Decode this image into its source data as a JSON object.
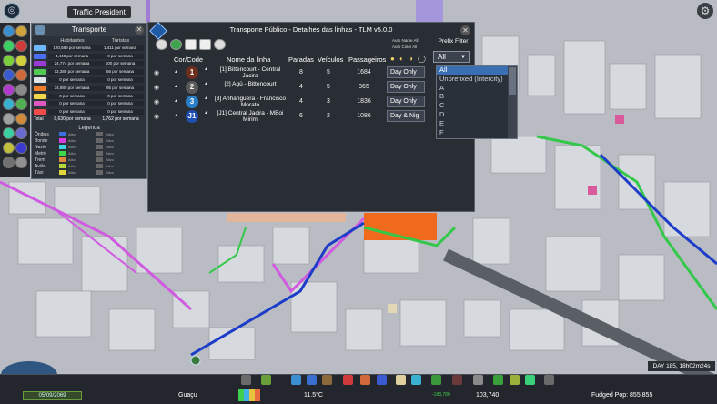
{
  "top": {
    "tag": "Traffic President"
  },
  "transport_panel": {
    "title": "Transporte",
    "headers": [
      "Habitantes",
      "Turistas"
    ],
    "rows": [
      {
        "color": "#6db8ff",
        "a": "120,589 por semana",
        "b": "1,411 por semana"
      },
      {
        "color": "#4b6ef4",
        "a": "4,440 por semana",
        "b": "0 por semana"
      },
      {
        "color": "#9a3bd8",
        "a": "24,774 por semana",
        "b": "100 por semana"
      },
      {
        "color": "#53c853",
        "a": "12,380 por semana",
        "b": "56 por semana"
      },
      {
        "color": "#dfe4ea",
        "a": "0 por semana",
        "b": "0 por semana"
      },
      {
        "color": "#ef7f2a",
        "a": "34,880 por semana",
        "b": "95 por semana"
      },
      {
        "color": "#f0d84a",
        "a": "0 por semana",
        "b": "0 por semana"
      },
      {
        "color": "#e056c0",
        "a": "0 por semana",
        "b": "0 por semana"
      },
      {
        "color": "#f04b4b",
        "a": "0 por semana",
        "b": "0 por semana"
      }
    ],
    "total_label": "Total",
    "total_a": "8,630 por semana",
    "total_b": "1,762 por semana",
    "legend_title": "Legenda",
    "legend": [
      {
        "name": "Ônibus",
        "color": "#3b6fe0",
        "a": "Ativo",
        "b": "Ativo"
      },
      {
        "name": "Bonde",
        "color": "#d83be0",
        "a": "Ativo",
        "b": "Ativo"
      },
      {
        "name": "Navio",
        "color": "#3bd4e0",
        "a": "Ativo",
        "b": "Ativo"
      },
      {
        "name": "Metrô",
        "color": "#3bd84a",
        "a": "Ativo",
        "b": "Ativo"
      },
      {
        "name": "Trem",
        "color": "#e0883b",
        "a": "Ativo",
        "b": "Ativo"
      },
      {
        "name": "Avião",
        "color": "#b4d83b",
        "a": "Ativo",
        "b": "Ativo"
      },
      {
        "name": "Táxi",
        "color": "#e0d83b",
        "a": "Ativo",
        "b": "Ativo"
      }
    ]
  },
  "detail_window": {
    "title": "Transporte Público - Detalhes das linhas - TLM v5.0.0",
    "auto_name": "Auto Name All",
    "auto_color": "Auto Color All",
    "prefix_filter": "Prefix Filter",
    "col_color": "Cor/Code",
    "col_name": "Nome da linha",
    "col_stops": "Paradas",
    "col_vehicles": "Veículos",
    "col_passengers": "Passageiros",
    "lines": [
      {
        "code": "1",
        "code_color": "#6e2e1e",
        "name": "[1] Bittencourt - Central Jacira",
        "stops": "8",
        "vehicles": "5",
        "passengers": "1684",
        "time": "Day Only"
      },
      {
        "code": "2",
        "code_color": "#5a5a5a",
        "name": "[2] Agü - Bittencourt",
        "stops": "4",
        "vehicles": "5",
        "passengers": "365",
        "time": "Day Only"
      },
      {
        "code": "3",
        "code_color": "#2a7fc8",
        "name": "[3] Anhanguera - Francisco Morato",
        "stops": "4",
        "vehicles": "3",
        "passengers": "1836",
        "time": "Day Only"
      },
      {
        "code": "J1",
        "code_color": "#1f4fb3",
        "name": "[J1] Central Jacira - MBoi Mirim",
        "stops": "6",
        "vehicles": "2",
        "passengers": "1086",
        "time": "Day & Nig"
      }
    ],
    "prefix_selected": "All",
    "prefix_options": [
      "All",
      "Unprefixed (Intercity)",
      "A",
      "B",
      "C",
      "D",
      "E",
      "F"
    ]
  },
  "bottom": {
    "day": "DAY 185, 18h02m24s",
    "date": "05/09/2069",
    "city": "Guaçu",
    "temperature": "11.5°C",
    "money": "103,740",
    "population": "Fudged Pop: 855,855",
    "income_neg": "-183,780",
    "income_pos": "+38,190"
  }
}
